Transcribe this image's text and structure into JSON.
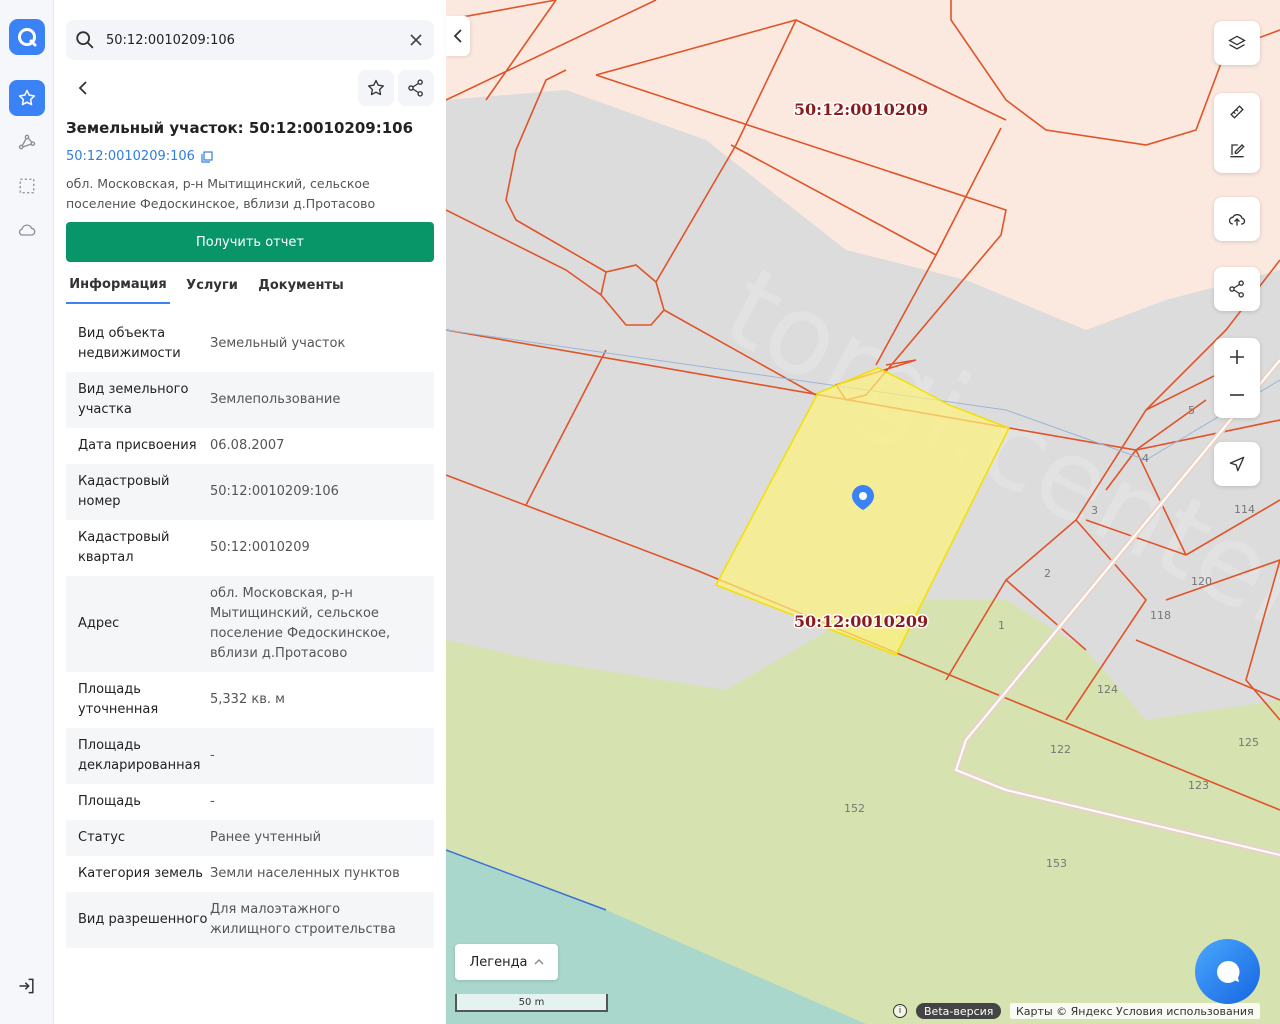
{
  "search": {
    "value": "50:12:0010209:106"
  },
  "title": "Земельный участок: 50:12:0010209:106",
  "cad_link": "50:12:0010209:106",
  "address": "обл. Московская, р-н Мытищинский, сельское поселение Федоскинское, вблизи д.Протасово",
  "report_button": "Получить отчет",
  "tabs": [
    "Информация",
    "Услуги",
    "Документы"
  ],
  "info": [
    {
      "k": "Вид объекта недвижимости",
      "v": "Земельный участок"
    },
    {
      "k": "Вид земельного участка",
      "v": "Землепользование"
    },
    {
      "k": "Дата присвоения",
      "v": "06.08.2007"
    },
    {
      "k": "Кадастровый номер",
      "v": "50:12:0010209:106"
    },
    {
      "k": "Кадастровый квартал",
      "v": "50:12:0010209"
    },
    {
      "k": "Адрес",
      "v": "обл. Московская, р-н Мытищинский, сельское поселение Федоскинское, вблизи д.Протасово"
    },
    {
      "k": "Площадь уточненная",
      "v": "5,332 кв. м"
    },
    {
      "k": "Площадь декларированная",
      "v": "-"
    },
    {
      "k": "Площадь",
      "v": "-"
    },
    {
      "k": "Статус",
      "v": "Ранее учтенный"
    },
    {
      "k": "Категория земель",
      "v": "Земли населенных пунктов"
    },
    {
      "k": "Вид разрешенного",
      "v": "Для малоэтажного жилищного строительства"
    }
  ],
  "map": {
    "quarter_labels": [
      "50:12:0010209",
      "50:12:0010209"
    ],
    "parcel_numbers": [
      "5",
      "4",
      "3",
      "2",
      "1",
      "114",
      "120",
      "118",
      "124",
      "122",
      "125",
      "123",
      "152",
      "153"
    ],
    "legend": "Легенда",
    "scale": "50 m",
    "beta": "Beta-версия",
    "attribution": "Карты © Яндекс  Условия использования",
    "info_symbol": "i"
  },
  "colors": {
    "accent": "#3b82f6",
    "report": "#089669",
    "parcel_line": "#e0542a",
    "selected": "#fff27a"
  }
}
